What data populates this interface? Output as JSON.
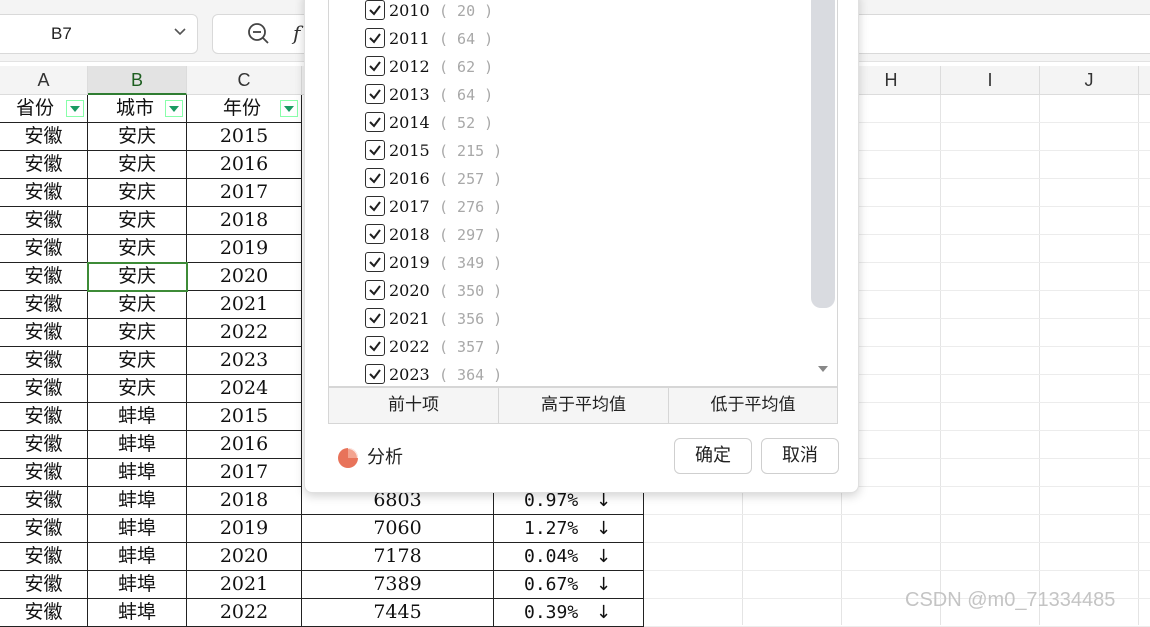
{
  "namebox": {
    "value": "B7"
  },
  "formula_bar": {
    "fx_label": "f"
  },
  "columns": [
    "A",
    "B",
    "C",
    "H",
    "I",
    "J"
  ],
  "header_row": {
    "province": "省份",
    "city": "城市",
    "year": "年份"
  },
  "rows": [
    {
      "province": "安徽",
      "city": "安庆",
      "year": "2015"
    },
    {
      "province": "安徽",
      "city": "安庆",
      "year": "2016"
    },
    {
      "province": "安徽",
      "city": "安庆",
      "year": "2017"
    },
    {
      "province": "安徽",
      "city": "安庆",
      "year": "2018"
    },
    {
      "province": "安徽",
      "city": "安庆",
      "year": "2019"
    },
    {
      "province": "安徽",
      "city": "安庆",
      "year": "2020"
    },
    {
      "province": "安徽",
      "city": "安庆",
      "year": "2021"
    },
    {
      "province": "安徽",
      "city": "安庆",
      "year": "2022"
    },
    {
      "province": "安徽",
      "city": "安庆",
      "year": "2023"
    },
    {
      "province": "安徽",
      "city": "安庆",
      "year": "2024"
    },
    {
      "province": "安徽",
      "city": "蚌埠",
      "year": "2015"
    },
    {
      "province": "安徽",
      "city": "蚌埠",
      "year": "2016"
    },
    {
      "province": "安徽",
      "city": "蚌埠",
      "year": "2017"
    },
    {
      "province": "安徽",
      "city": "蚌埠",
      "year": "2018",
      "value": "6803",
      "rate": "0.97%",
      "arrow": "↓"
    },
    {
      "province": "安徽",
      "city": "蚌埠",
      "year": "2019",
      "value": "7060",
      "rate": "1.27%",
      "arrow": "↓"
    },
    {
      "province": "安徽",
      "city": "蚌埠",
      "year": "2020",
      "value": "7178",
      "rate": "0.04%",
      "arrow": "↓"
    },
    {
      "province": "安徽",
      "city": "蚌埠",
      "year": "2021",
      "value": "7389",
      "rate": "0.67%",
      "arrow": "↓"
    },
    {
      "province": "安徽",
      "city": "蚌埠",
      "year": "2022",
      "value": "7445",
      "rate": "0.39%",
      "arrow": "↓"
    }
  ],
  "filter_popup": {
    "items": [
      {
        "year": "2010",
        "count": "( 20 )",
        "checked": true
      },
      {
        "year": "2011",
        "count": "( 64 )",
        "checked": true
      },
      {
        "year": "2012",
        "count": "( 62 )",
        "checked": true
      },
      {
        "year": "2013",
        "count": "( 64 )",
        "checked": true
      },
      {
        "year": "2014",
        "count": "( 52 )",
        "checked": true
      },
      {
        "year": "2015",
        "count": "( 215 )",
        "checked": true
      },
      {
        "year": "2016",
        "count": "( 257 )",
        "checked": true
      },
      {
        "year": "2017",
        "count": "( 276 )",
        "checked": true
      },
      {
        "year": "2018",
        "count": "( 297 )",
        "checked": true
      },
      {
        "year": "2019",
        "count": "( 349 )",
        "checked": true
      },
      {
        "year": "2020",
        "count": "( 350 )",
        "checked": true
      },
      {
        "year": "2021",
        "count": "( 356 )",
        "checked": true
      },
      {
        "year": "2022",
        "count": "( 357 )",
        "checked": true
      },
      {
        "year": "2023",
        "count": "( 364 )",
        "checked": true
      }
    ],
    "quick_buttons": {
      "top10": "前十项",
      "above_avg": "高于平均值",
      "below_avg": "低于平均值"
    },
    "analyze_label": "分析",
    "ok_label": "确定",
    "cancel_label": "取消"
  },
  "watermark": "CSDN @m0_71334485",
  "colors": {
    "selection": "#3d8b37",
    "filter_arrow": "#1a9b62",
    "analyze_icon": "#e8735a"
  }
}
